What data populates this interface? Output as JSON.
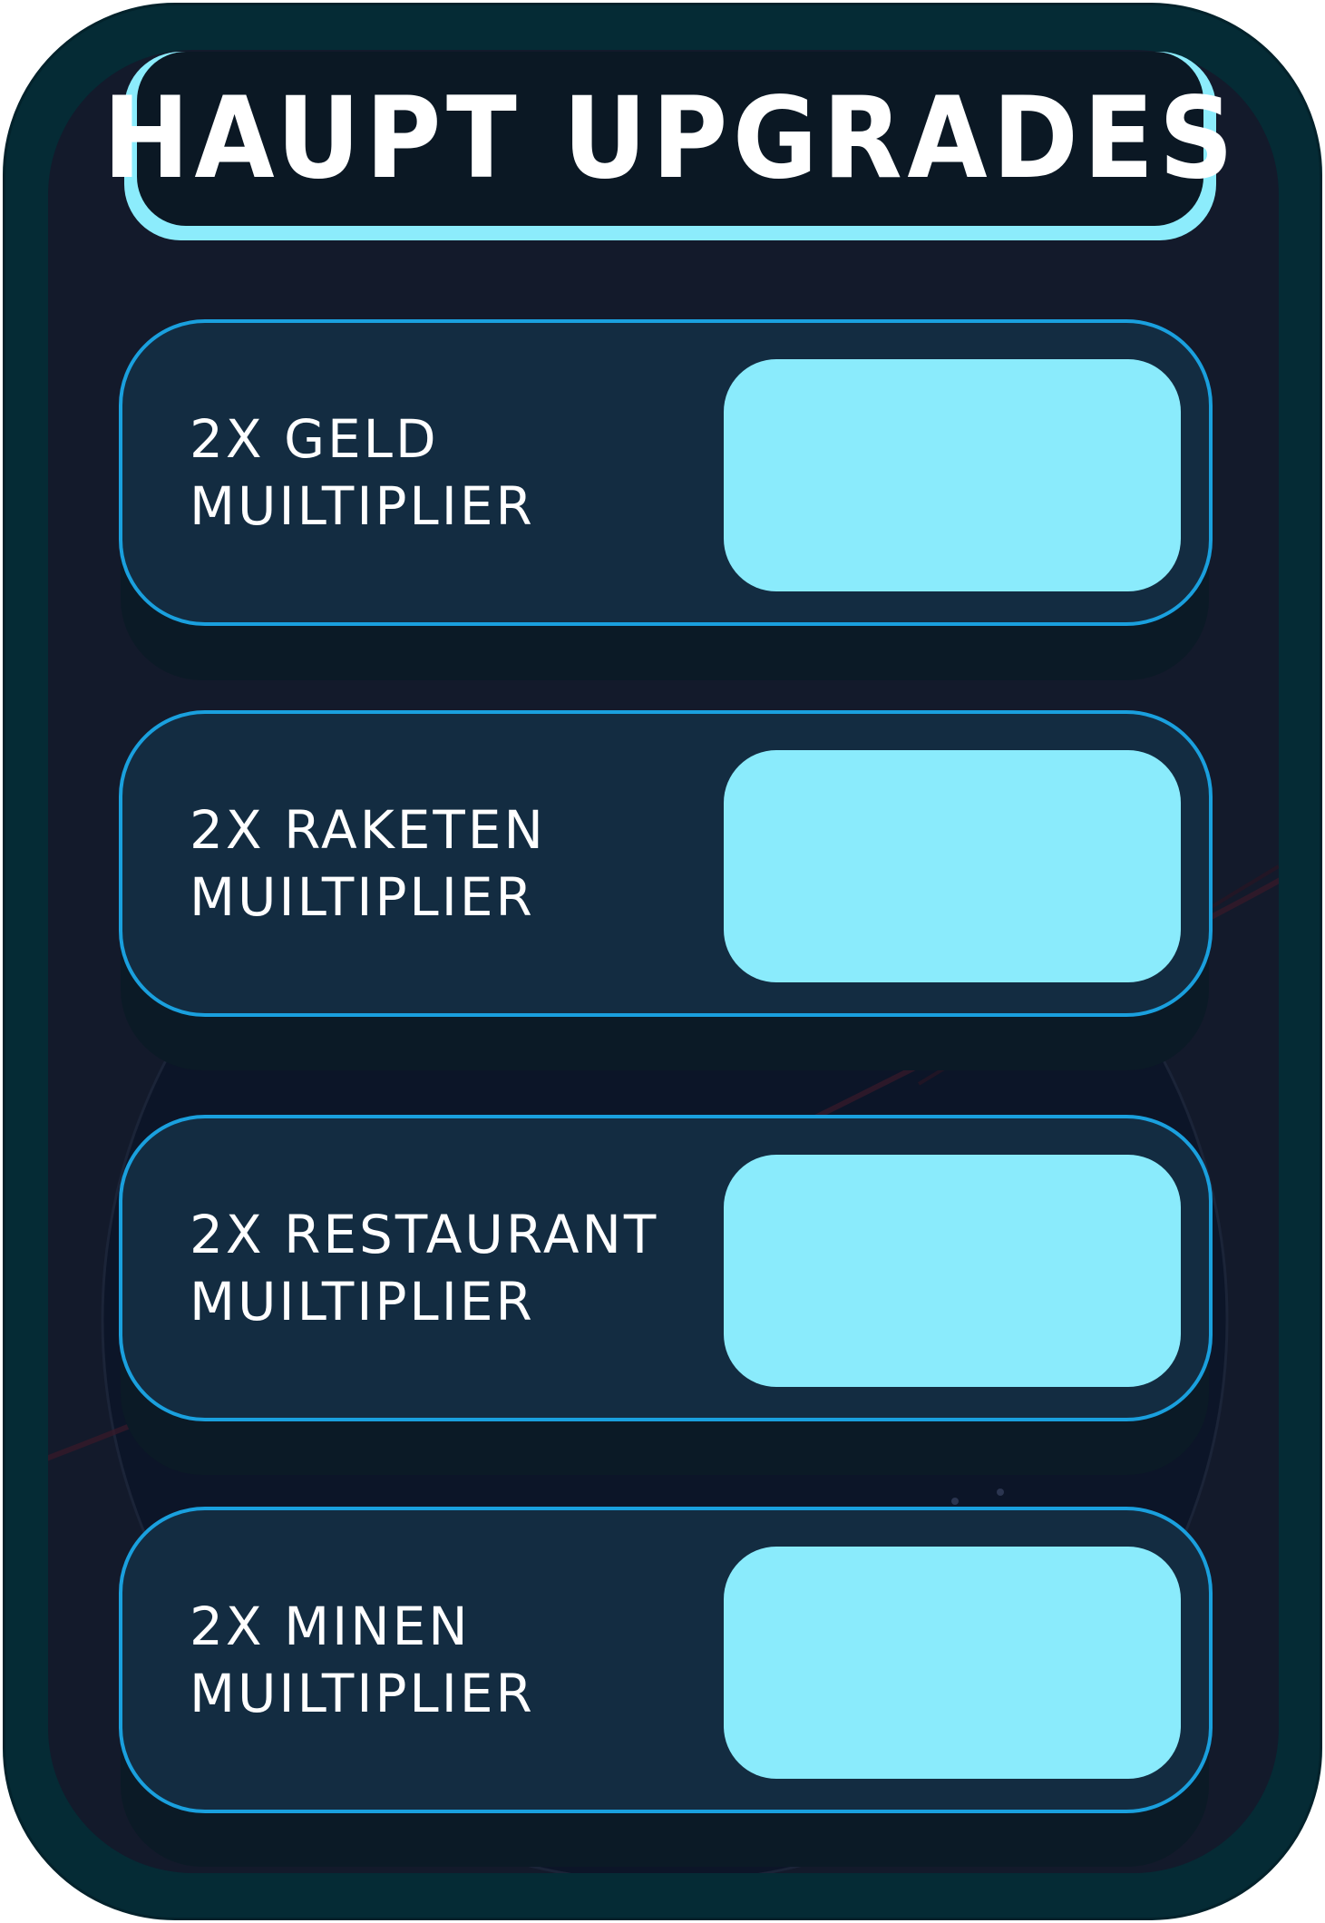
{
  "panel": {
    "title": "HAUPT UPGRADES"
  },
  "upgrades": [
    {
      "label": "2X GELD MUILTIPLIER",
      "button_label": ""
    },
    {
      "label": "2X RAKETEN MUILTIPLIER",
      "button_label": ""
    },
    {
      "label": "2X RESTAURANT MUILTIPLIER",
      "button_label": ""
    },
    {
      "label": "2X MINEN MUILTIPLIER",
      "button_label": ""
    }
  ],
  "colors": {
    "frame": "#052b35",
    "panel": "#131a2b",
    "title_border": "#8cecfc",
    "card_fill": "#132c41",
    "card_border": "#1aa0de",
    "button_fill": "#8aebfc"
  }
}
